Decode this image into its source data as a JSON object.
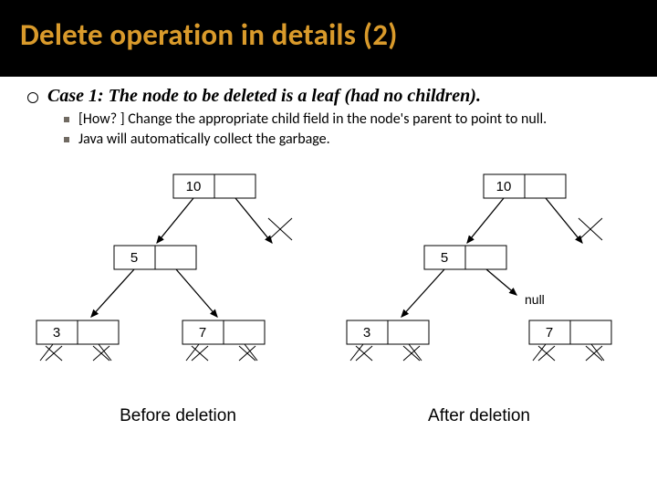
{
  "slide": {
    "title": "Delete operation in details (2)",
    "case_line": "Case 1: The node to be deleted is a leaf (had no children).",
    "sub": {
      "a": "[How? ] Change the appropriate child field in the node's parent to point to null.",
      "b": "Java will automatically collect the garbage."
    }
  },
  "tree": {
    "n10": "10",
    "n5": "5",
    "n3": "3",
    "n7": "7",
    "null": "null"
  },
  "captions": {
    "before": "Before deletion",
    "after": "After deletion"
  }
}
